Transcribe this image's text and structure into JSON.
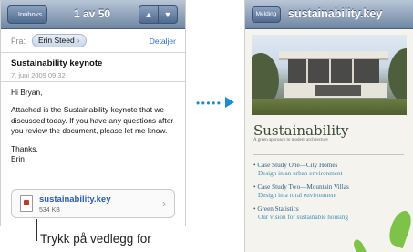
{
  "left_screen": {
    "nav": {
      "back_label": "Innboks",
      "counter": "1 av 50",
      "up_icon": "chevron-up-icon",
      "down_icon": "chevron-down-icon"
    },
    "header": {
      "from_label": "Fra:",
      "from_name": "Erin Steed",
      "details_label": "Detaljer"
    },
    "subject": "Sustainability keynote",
    "date": "7. juni 2009 09:32",
    "body": {
      "greeting": "Hi Bryan,",
      "paragraph": "Attached is the Sustainability keynote that we discussed today. If you have any questions after you review the document, please let me know.",
      "closing": "Thanks,",
      "signature": "Erin"
    },
    "attachment": {
      "name": "sustainability.key",
      "size": "534 KB"
    }
  },
  "caption": "Trykk på vedlegg for",
  "right_screen": {
    "nav": {
      "close_label": "Melding",
      "title": "sustainability.key"
    },
    "slide": {
      "heading": "Sustainability",
      "subtitle": "A green approach to modern architecture",
      "bullets": [
        {
          "title": "• Case Study One—City Homes",
          "desc": "Design in an urban environment"
        },
        {
          "title": "• Case Study Two—Mountain Villas",
          "desc": "Design in a rural environment"
        },
        {
          "title": "• Green Statistics",
          "desc": "Our vision for sustainable housing"
        }
      ]
    }
  },
  "colors": {
    "nav_gradient_top": "#b9c6d6",
    "nav_gradient_bottom": "#6f86a3",
    "link_blue": "#2f6cc7",
    "arrow_blue": "#1f8bd1",
    "attachment_blue": "#2b5ea7"
  }
}
